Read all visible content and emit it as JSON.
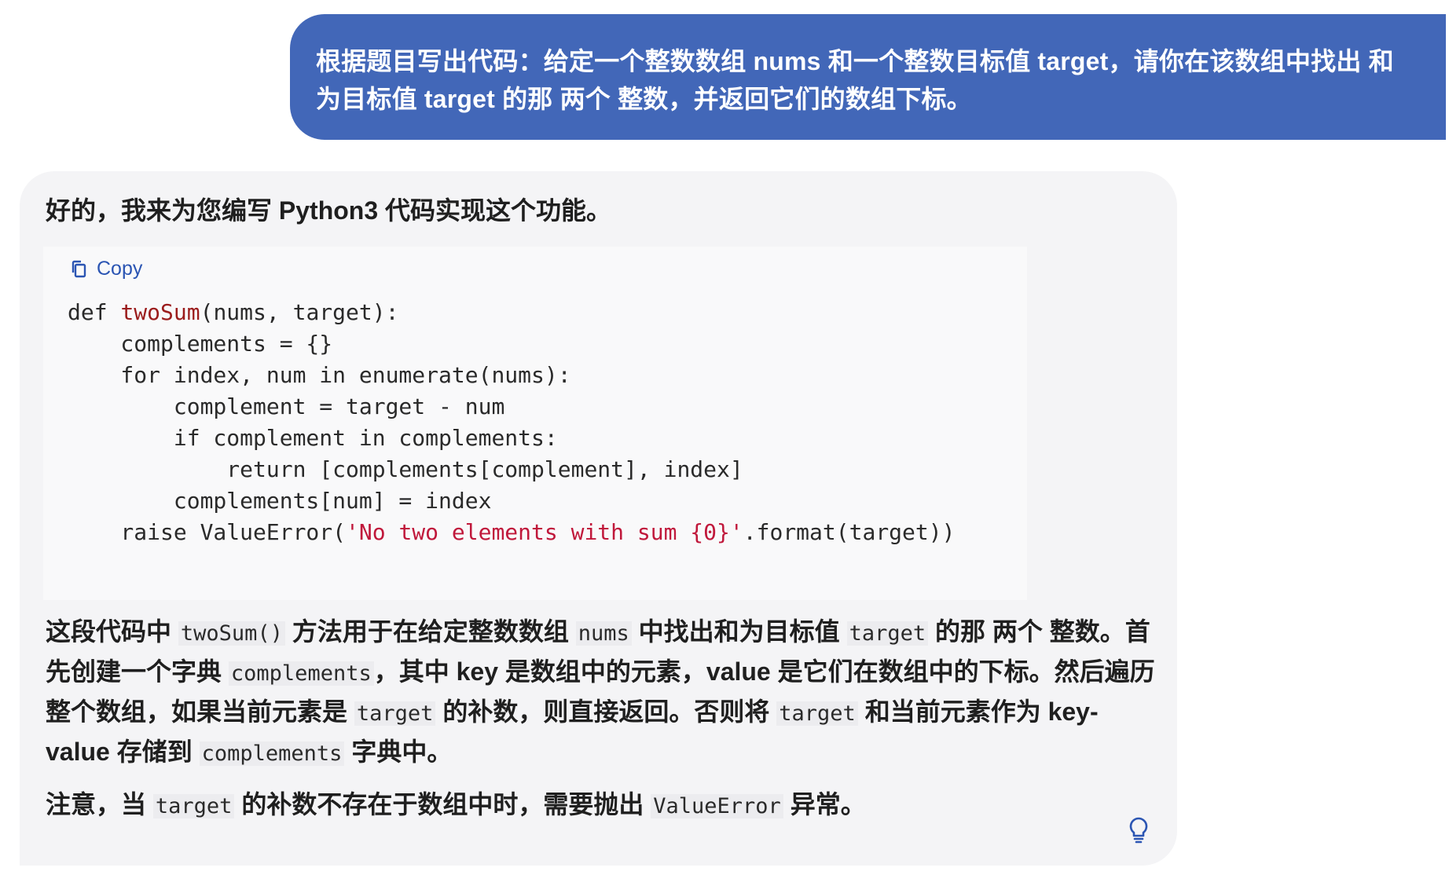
{
  "user_message": {
    "text": "根据题目写出代码：给定一个整数数组 nums 和一个整数目标值 target，请你在该数组中找出 和为目标值 target 的那 两个 整数，并返回它们的数组下标。"
  },
  "assistant_message": {
    "intro": "好的，我来为您编写 Python3 代码实现这个功能。",
    "copy_label": "Copy",
    "code": {
      "l1_kw": "def ",
      "l1_fn": "twoSum",
      "l1_rest": "(nums, target):",
      "l2": "    complements = {}",
      "l3": "    for index, num in enumerate(nums):",
      "l4": "        complement = target - num",
      "l5": "        if complement in complements:",
      "l6": "            return [complements[complement], index]",
      "l7": "        complements[num] = index",
      "l8_pre": "    raise ValueError(",
      "l8_str": "'No two elements with sum {0}'",
      "l8_post": ".format(target))"
    },
    "explanation": {
      "p1_a": "这段代码中 ",
      "p1_code1": "twoSum()",
      "p1_b": " 方法用于在给定整数数组 ",
      "p1_code2": "nums",
      "p1_c": " 中找出和为目标值 ",
      "p1_code3": "target",
      "p1_d": " 的那 两个 整数。首先创建一个字典 ",
      "p1_code4": "complements",
      "p1_e": "，其中 key 是数组中的元素，value 是它们在数组中的下标。然后遍历整个数组，如果当前元素是 ",
      "p1_code5": "target",
      "p1_f": " 的补数，则直接返回。否则将 ",
      "p1_code6": "target",
      "p1_g": " 和当前元素作为 key-value 存储到 ",
      "p1_code7": "complements",
      "p1_h": " 字典中。",
      "p2_a": "注意，当 ",
      "p2_code1": "target",
      "p2_b": " 的补数不存在于数组中时，需要抛出 ",
      "p2_code2": "ValueError",
      "p2_c": " 异常。"
    },
    "icons": {
      "copy": "copy-icon",
      "hint": "lightbulb-icon"
    }
  },
  "colors": {
    "user_bubble": "#4267b8",
    "assistant_bubble": "#f4f4f6",
    "code_bg": "#f9f9fa",
    "link": "#2b55b3",
    "function_name": "#9b1c1c",
    "string": "#c0183b"
  }
}
